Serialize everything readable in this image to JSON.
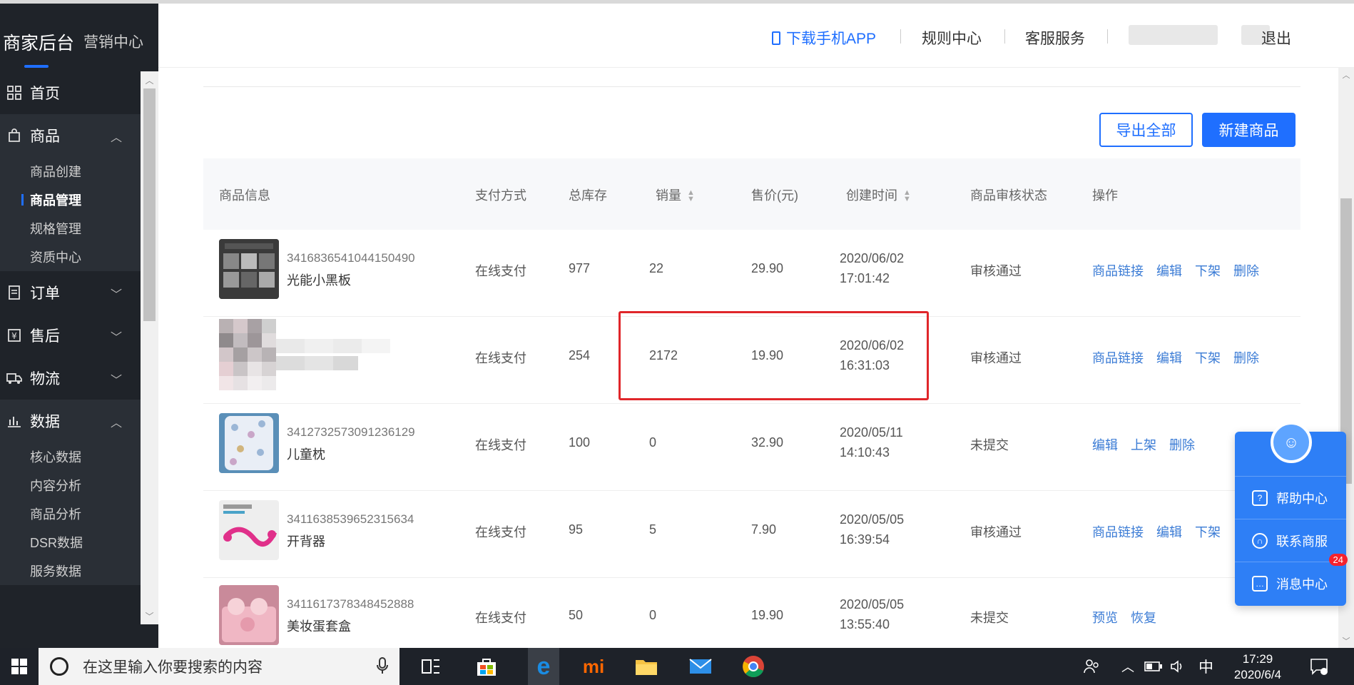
{
  "brand": {
    "title": "商家后台",
    "sub": "营销中心"
  },
  "header": {
    "download": "下载手机APP",
    "rules": "规则中心",
    "service": "客服服务",
    "logout": "退出"
  },
  "sidebar": {
    "home": "首页",
    "goods": "商品",
    "goods_items": [
      "商品创建",
      "商品管理",
      "规格管理",
      "资质中心"
    ],
    "orders": "订单",
    "aftersale": "售后",
    "logistics": "物流",
    "data": "数据",
    "data_items": [
      "核心数据",
      "内容分析",
      "商品分析",
      "DSR数据",
      "服务数据"
    ]
  },
  "actions": {
    "export_all": "导出全部",
    "new_product": "新建商品"
  },
  "table": {
    "headers": {
      "info": "商品信息",
      "pay": "支付方式",
      "stock": "总库存",
      "sales": "销量",
      "price": "售价(元)",
      "created": "创建时间",
      "status": "商品审核状态",
      "ops": "操作"
    },
    "rows": [
      {
        "id": "3416836541044150490",
        "name": "光能小黑板",
        "pay": "在线支付",
        "stock": "977",
        "sales": "22",
        "price": "29.90",
        "date": "2020/06/02",
        "time": "17:01:42",
        "status": "审核通过",
        "ops": [
          "商品链接",
          "编辑",
          "下架",
          "删除"
        ]
      },
      {
        "id": "",
        "name": "",
        "pay": "在线支付",
        "stock": "254",
        "sales": "2172",
        "price": "19.90",
        "date": "2020/06/02",
        "time": "16:31:03",
        "status": "审核通过",
        "ops": [
          "商品链接",
          "编辑",
          "下架",
          "删除"
        ]
      },
      {
        "id": "3412732573091236129",
        "name": "儿童枕",
        "pay": "在线支付",
        "stock": "100",
        "sales": "0",
        "price": "32.90",
        "date": "2020/05/11",
        "time": "14:10:43",
        "status": "未提交",
        "ops": [
          "编辑",
          "上架",
          "删除"
        ]
      },
      {
        "id": "3411638539652315634",
        "name": "开背器",
        "pay": "在线支付",
        "stock": "95",
        "sales": "5",
        "price": "7.90",
        "date": "2020/05/05",
        "time": "16:39:54",
        "status": "审核通过",
        "ops": [
          "商品链接",
          "编辑",
          "下架"
        ]
      },
      {
        "id": "3411617378348452888",
        "name": "美妆蛋套盒",
        "pay": "在线支付",
        "stock": "50",
        "sales": "0",
        "price": "19.90",
        "date": "2020/05/05",
        "time": "13:55:40",
        "status": "未提交",
        "ops": [
          "预览",
          "恢复"
        ]
      }
    ]
  },
  "float": {
    "help": "帮助中心",
    "contact": "联系商服",
    "messages": "消息中心",
    "badge": "24"
  },
  "taskbar": {
    "search_placeholder": "在这里输入你要搜索的内容",
    "ime": "中",
    "time": "17:29",
    "date": "2020/6/4"
  },
  "colors": {
    "primary": "#1f6fff",
    "sidebar": "#1f2329",
    "highlight": "#e0262a",
    "link": "#3a7bd5"
  }
}
